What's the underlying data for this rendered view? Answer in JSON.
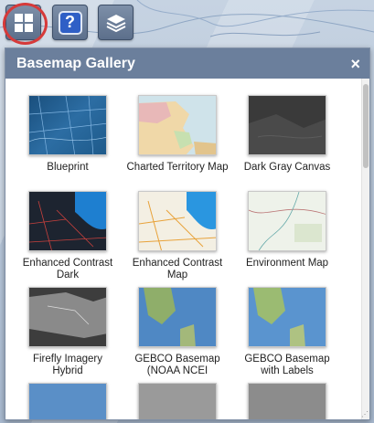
{
  "toolbar": {
    "basemap_icon": "grid-icon",
    "help_label": "?",
    "layers_icon": "layers-icon"
  },
  "panel": {
    "title": "Basemap Gallery",
    "close_label": "×"
  },
  "tiles": [
    {
      "label": "Blueprint"
    },
    {
      "label": "Charted Territory Map"
    },
    {
      "label": "Dark Gray Canvas"
    },
    {
      "label": "Enhanced Contrast Dark"
    },
    {
      "label": "Enhanced Contrast Map"
    },
    {
      "label": "Environment Map"
    },
    {
      "label": "Firefly Imagery Hybrid"
    },
    {
      "label": "GEBCO Basemap (NOAA NCEI"
    },
    {
      "label": "GEBCO Basemap with Labels"
    },
    {
      "label": ""
    },
    {
      "label": ""
    },
    {
      "label": ""
    }
  ],
  "colors": {
    "header": "#6b7f9c",
    "toolbar_button": "#6a7d98",
    "highlight": "#d63a3a",
    "help_blue": "#2f5fc6"
  }
}
